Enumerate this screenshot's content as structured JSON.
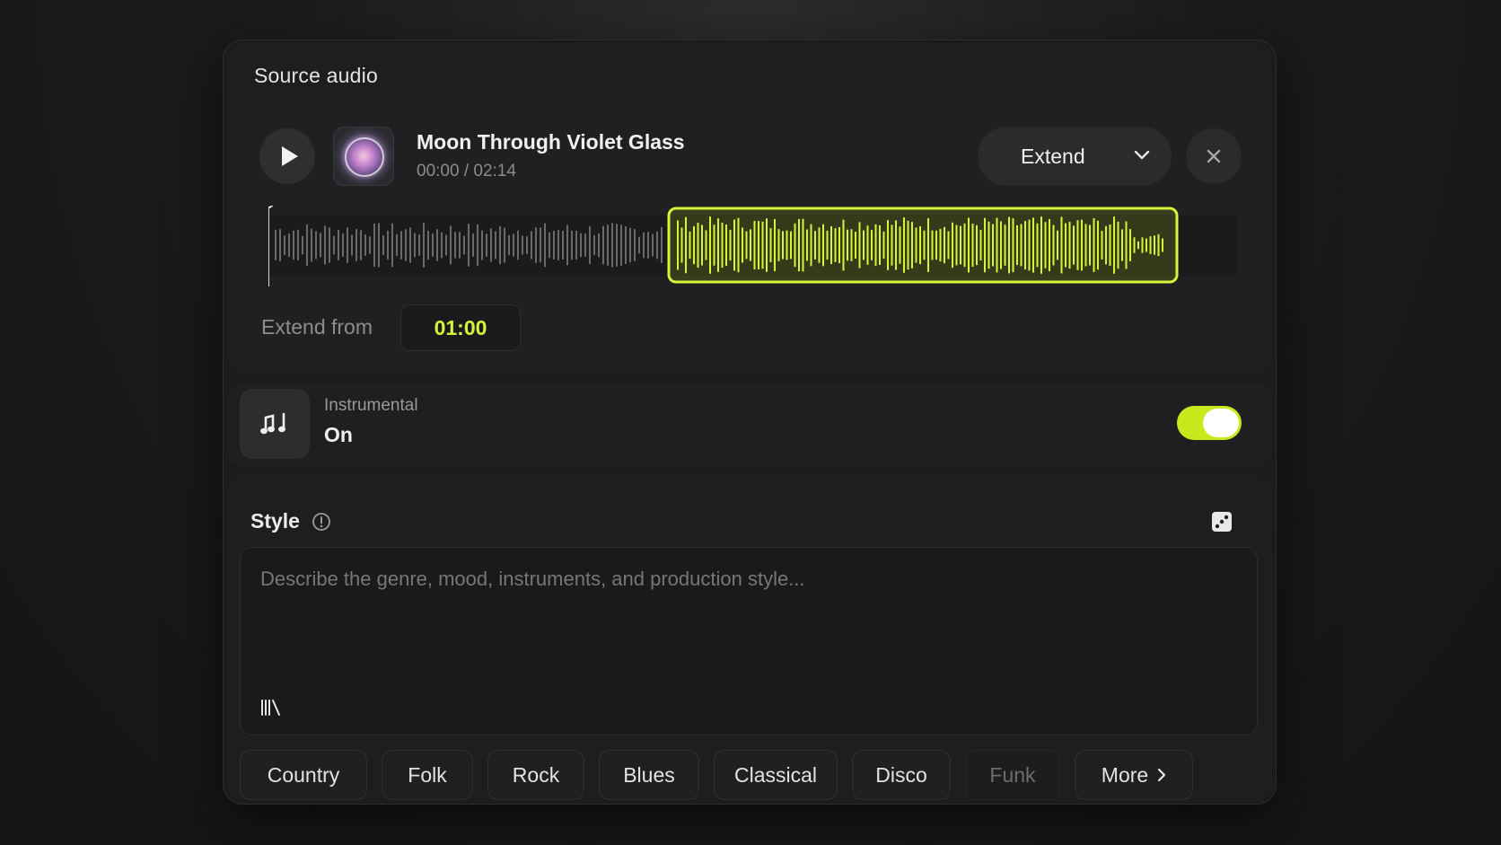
{
  "source": {
    "section_title": "Source audio",
    "track_title": "Moon Through Violet Glass",
    "time_display": "00:00 / 02:14",
    "mode_label": "Extend",
    "extend_from_label": "Extend from",
    "extend_from_value": "01:00",
    "accent_color": "#d9f23a"
  },
  "instrumental": {
    "label": "Instrumental",
    "value": "On",
    "enabled": true
  },
  "style": {
    "title": "Style",
    "placeholder": "Describe the genre, mood, instruments, and production style...",
    "chips": [
      {
        "label": "Country"
      },
      {
        "label": "Folk"
      },
      {
        "label": "Rock"
      },
      {
        "label": "Blues"
      },
      {
        "label": "Classical"
      },
      {
        "label": "Disco"
      },
      {
        "label": "Funk"
      }
    ],
    "more_label": "More"
  },
  "icons": {
    "play": "play-icon",
    "close": "close-icon",
    "chevron": "chevron-down-icon",
    "music": "music-notes-icon",
    "info": "info-icon",
    "dice": "dice-icon",
    "library": "library-icon",
    "chevron_right": "chevron-right-icon"
  }
}
